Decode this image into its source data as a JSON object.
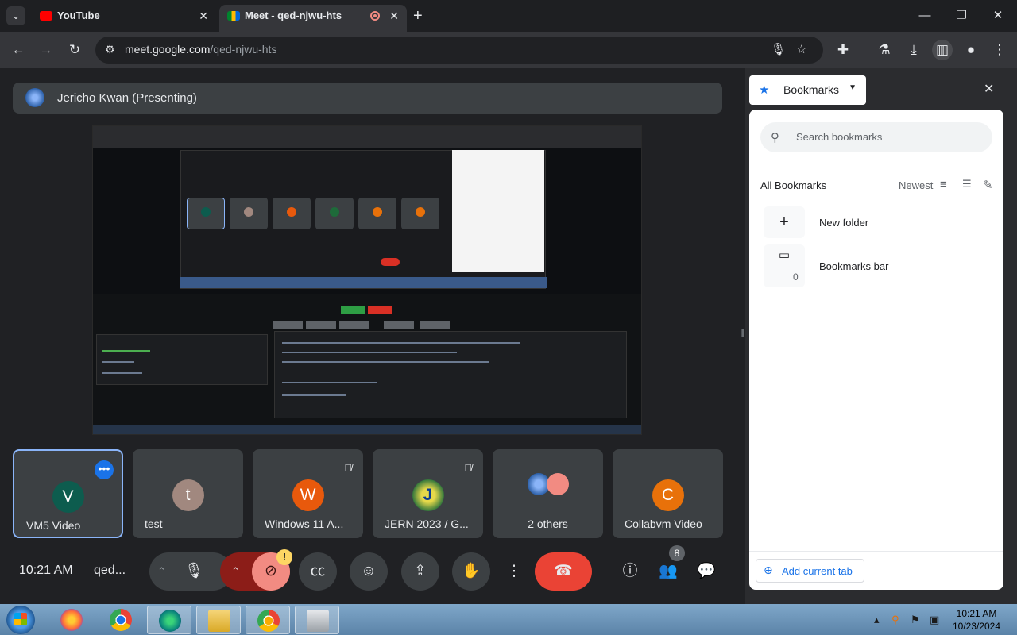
{
  "browser": {
    "tabs": [
      {
        "title": "YouTube",
        "active": false
      },
      {
        "title": "Meet - qed-njwu-hts",
        "active": true
      }
    ],
    "url_host": "meet.google.com",
    "url_path": "/qed-njwu-hts",
    "icons": {
      "back": "back-arrow-icon",
      "forward": "forward-arrow-icon",
      "reload": "reload-icon",
      "mic": "microphone-icon",
      "star": "star-icon",
      "extensions": "puzzle-icon",
      "labs": "flask-icon",
      "download": "download-icon",
      "sidepanel": "side-panel-icon",
      "profile": "profile-icon",
      "menu": "kebab-menu-icon"
    }
  },
  "meet": {
    "presenter_label": "Jericho Kwan (Presenting)",
    "time": "10:21 AM",
    "meeting_code": "qed...",
    "participant_count_badge": "8",
    "camera_warning": "!",
    "participants": [
      {
        "initial": "V",
        "name": "VM5 Video",
        "color": "#0d5c4e",
        "selected": true
      },
      {
        "initial": "t",
        "name": "test",
        "color": "#a1887f",
        "selected": false
      },
      {
        "initial": "W",
        "name": "Windows 11 A...",
        "color": "#e8590c",
        "muted": true
      },
      {
        "initial": "J",
        "name": "JERN 2023 / G...",
        "color": "#1e6b3a",
        "muted": true
      },
      {
        "initial": "",
        "name": "2 others",
        "color": "#5f6368"
      },
      {
        "initial": "C",
        "name": "Collabvm Video",
        "color": "#e8710a"
      }
    ],
    "colors": {
      "end_call": "#ea4335",
      "accent": "#8ab4f8",
      "camera_off": "#f28b82"
    }
  },
  "bookmarks": {
    "panel_title": "Bookmarks",
    "search_placeholder": "Search bookmarks",
    "section_title": "All Bookmarks",
    "sort_label": "Newest",
    "new_folder_label": "New folder",
    "folder_label": "Bookmarks bar",
    "folder_count": "0",
    "add_current_tab_label": "Add current tab"
  },
  "taskbar": {
    "time": "10:21 AM",
    "date": "10/23/2024",
    "apps": [
      "firefox",
      "chrome",
      "edge",
      "file-explorer",
      "chrome-canary",
      "preview"
    ]
  }
}
